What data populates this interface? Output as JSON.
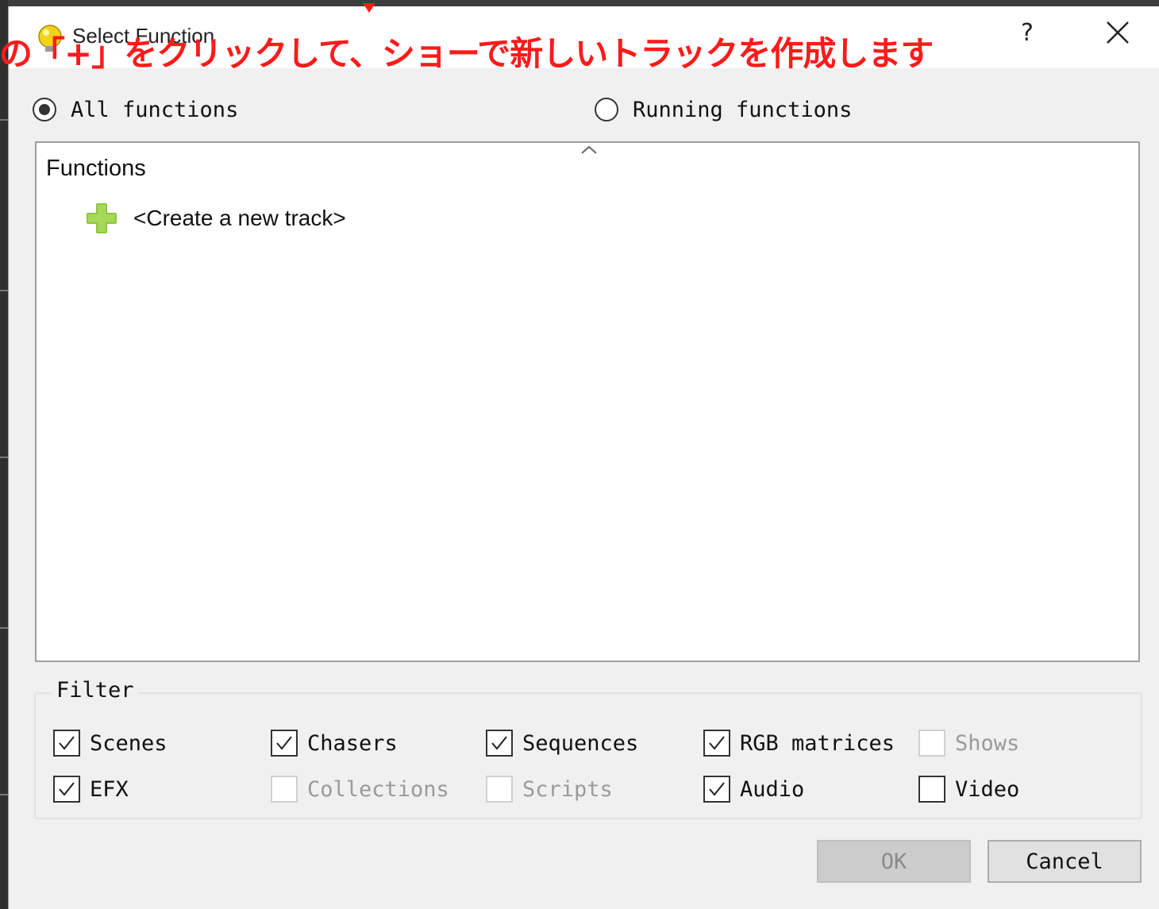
{
  "dialog": {
    "title": "Select Function",
    "help_glyph": "?",
    "close_glyph": "✕"
  },
  "annotation": {
    "text": "の「+」をクリックして、ショーで新しいトラックを作成します",
    "color": "#ff1a1a"
  },
  "scope": {
    "all_label": "All functions",
    "running_label": "Running functions",
    "selected": "All functions"
  },
  "list": {
    "header": "Functions",
    "items": [
      {
        "label": "<Create a new track>",
        "icon": "plus-icon"
      }
    ]
  },
  "filter": {
    "title": "Filter",
    "options": [
      {
        "label": "Scenes",
        "checked": true,
        "enabled": true
      },
      {
        "label": "Chasers",
        "checked": true,
        "enabled": true
      },
      {
        "label": "Sequences",
        "checked": true,
        "enabled": true
      },
      {
        "label": "RGB matrices",
        "checked": true,
        "enabled": true
      },
      {
        "label": "Shows",
        "checked": false,
        "enabled": false
      },
      {
        "label": "EFX",
        "checked": true,
        "enabled": true
      },
      {
        "label": "Collections",
        "checked": false,
        "enabled": false
      },
      {
        "label": "Scripts",
        "checked": false,
        "enabled": false
      },
      {
        "label": "Audio",
        "checked": true,
        "enabled": true
      },
      {
        "label": "Video",
        "checked": false,
        "enabled": true
      }
    ]
  },
  "buttons": {
    "ok_label": "OK",
    "ok_enabled": false,
    "cancel_label": "Cancel"
  },
  "colors": {
    "dialog_bg": "#f0f0f0",
    "titlebar_bg": "#ffffff",
    "plus_green": "#8cc63f"
  }
}
